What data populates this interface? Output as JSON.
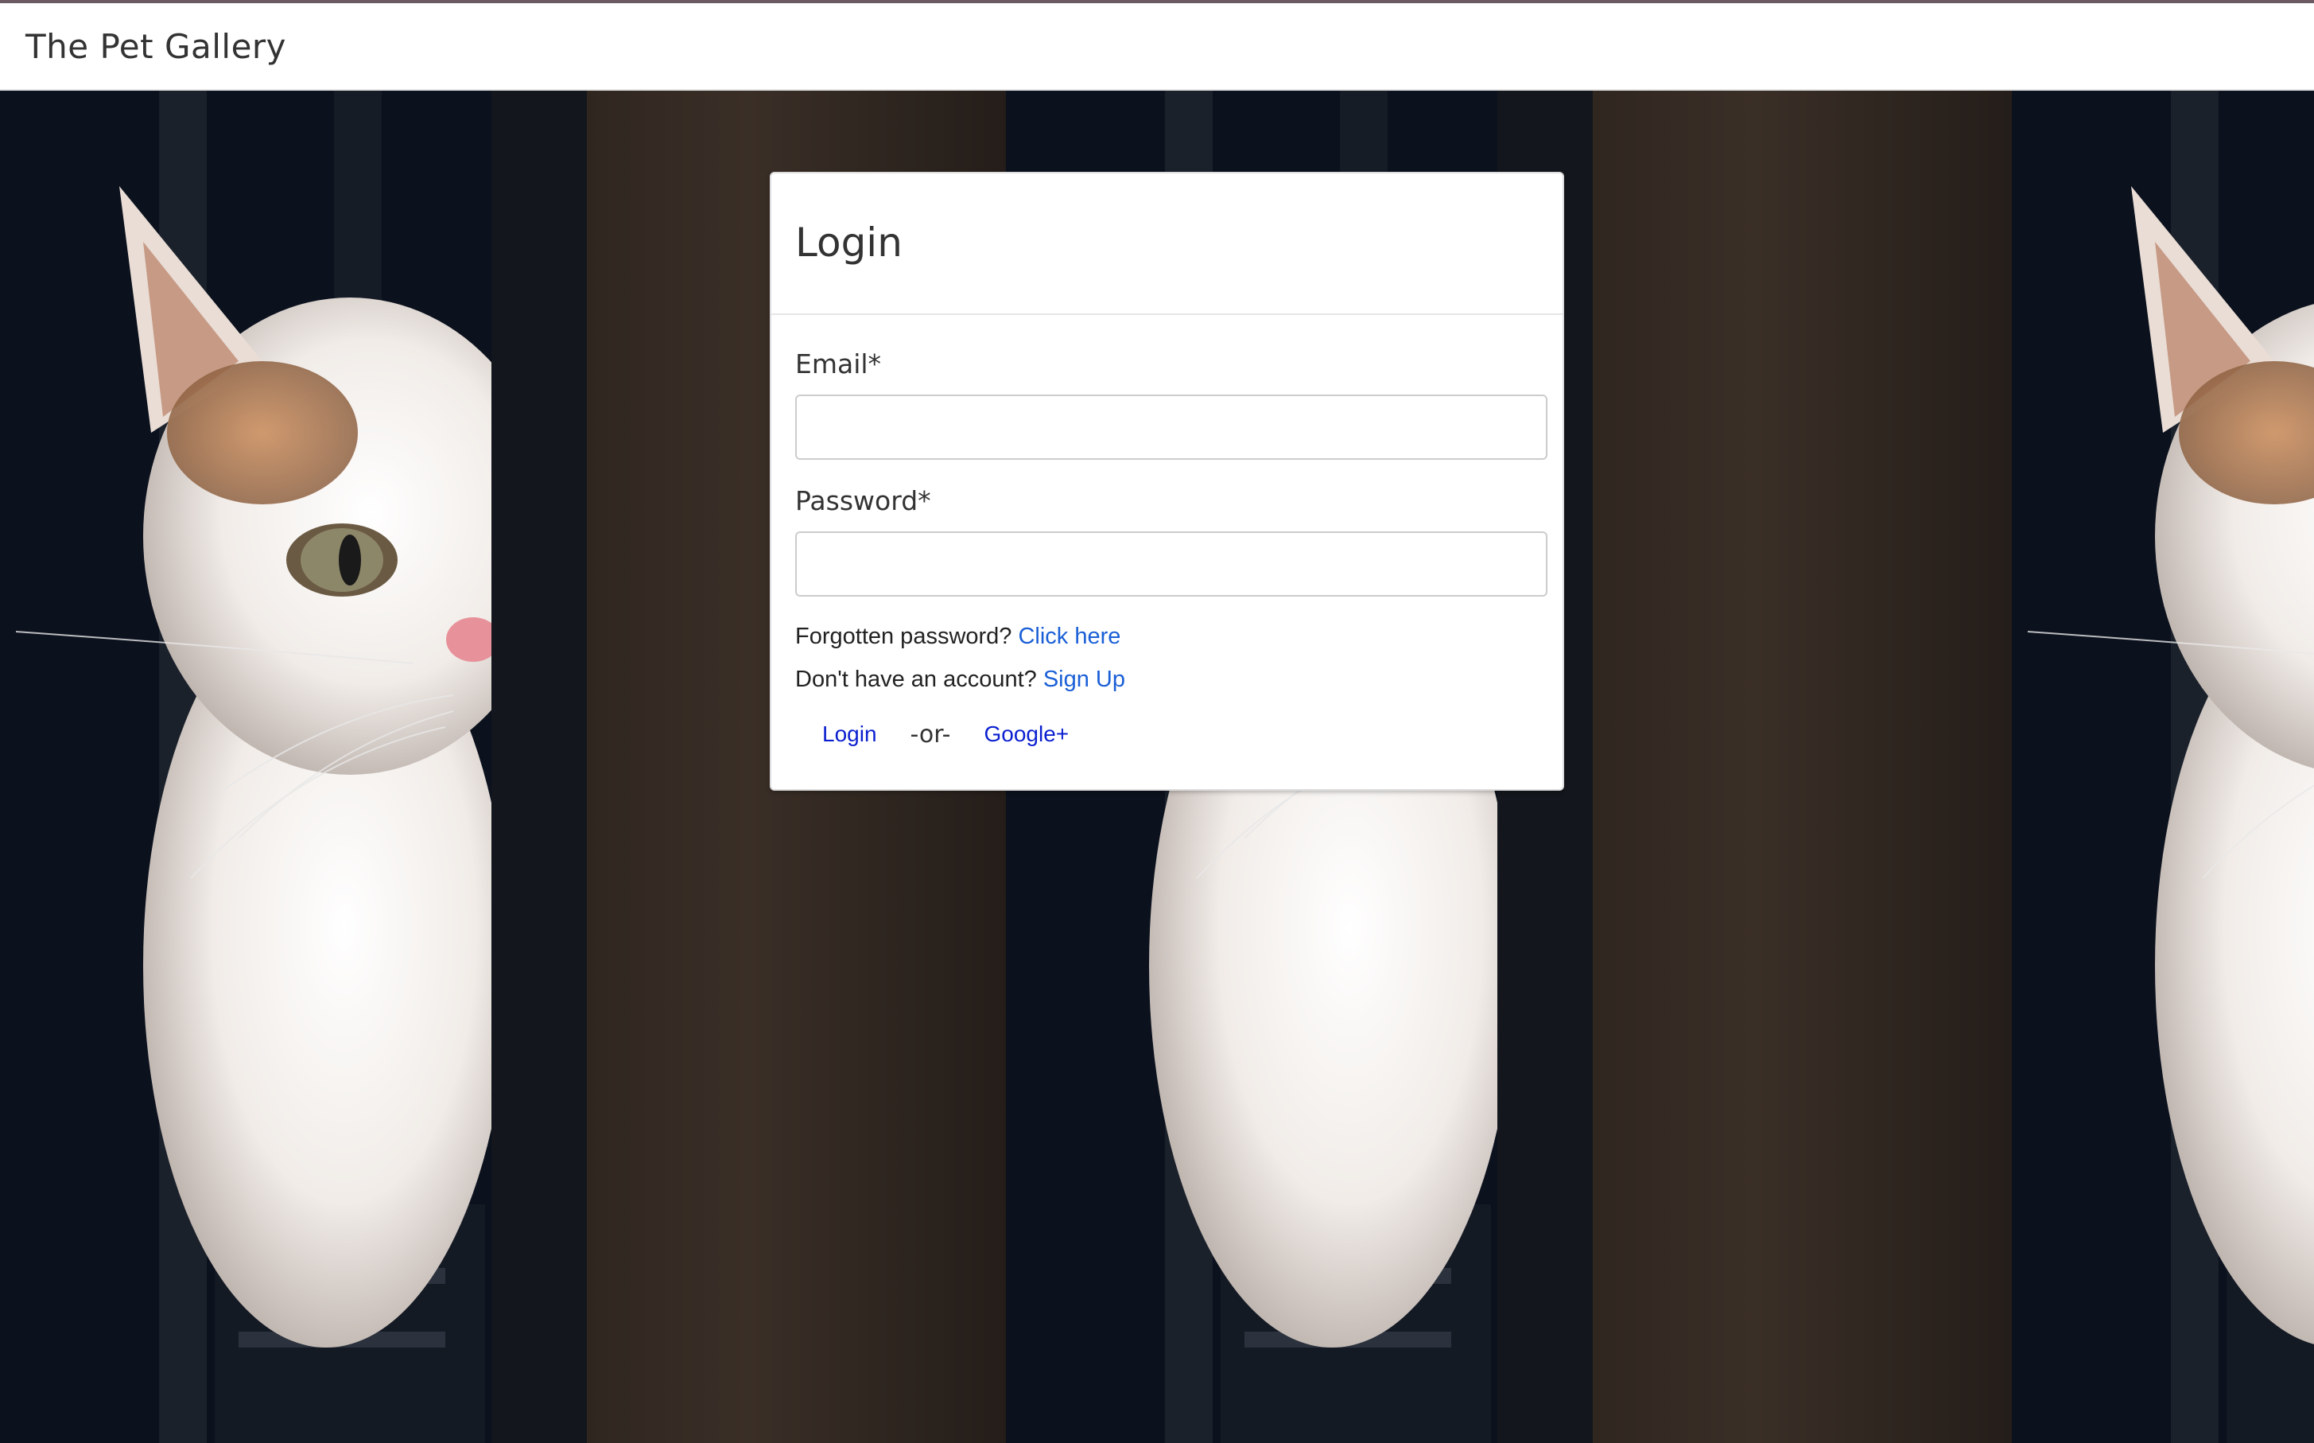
{
  "app": {
    "brand": "The Pet Gallery"
  },
  "login": {
    "title": "Login",
    "email_label": "Email*",
    "email_value": "",
    "password_label": "Password*",
    "password_value": "",
    "forgot_text": "Forgotten password?",
    "forgot_link": "Click here",
    "signup_text": "Don't have an account?",
    "signup_link": "Sign Up",
    "login_button": "Login",
    "separator": "-or-",
    "google_button": "Google+"
  },
  "colors": {
    "link": "#1a5fd6",
    "button_link": "#0b1fd0",
    "navbar_bg": "#ffffff",
    "background_dark": "#0c1220"
  },
  "background": {
    "image": "kitten-peeking-between-curtains",
    "repeat": "horizontal"
  }
}
